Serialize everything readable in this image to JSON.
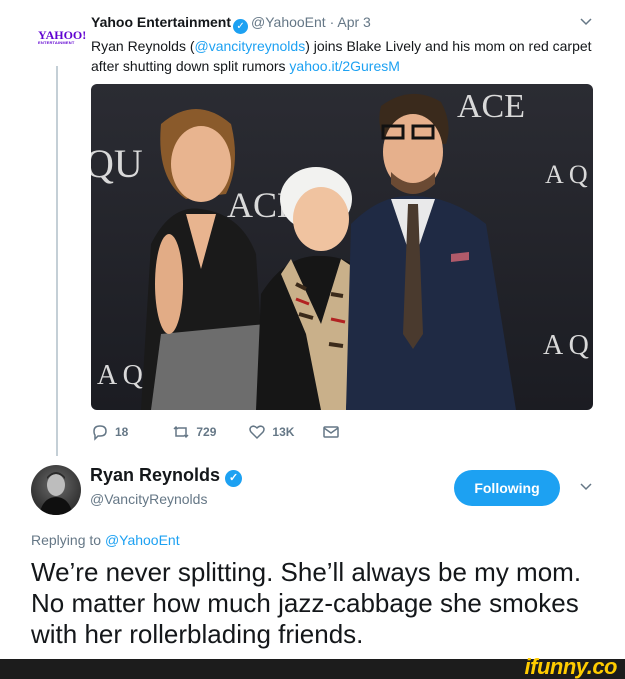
{
  "quoted_tweet": {
    "logo_text": "YAHOO!",
    "logo_subtext": "ENTERTAINMENT",
    "name": "Yahoo Entertainment",
    "verified_icon": "✓",
    "handle": "@YahooEnt",
    "separator": " · ",
    "date": "Apr 3",
    "text_before": "Ryan Reynolds (",
    "mention": "@vancityreynolds",
    "text_after": ") joins Blake Lively and his mom on red carpet after shutting down split rumors ",
    "link": "yahoo.it/2GuresM",
    "photo_text": {
      "ace_top": "ACE",
      "qu_left": "QU",
      "ace_mid": "ACE",
      "aq_right_top": "A Q",
      "aq_right_bottom": "A Q",
      "aq_left_bottom": "A Q"
    },
    "actions": {
      "replies": "18",
      "retweets": "729",
      "likes": "13K"
    }
  },
  "main_tweet": {
    "name": "Ryan Reynolds",
    "verified_icon": "✓",
    "handle": "@VancityReynolds",
    "follow_label": "Following",
    "replying_prefix": "Replying to ",
    "replying_to": "@YahooEnt",
    "text": "We’re never splitting. She’ll always be my mom. No matter how much jazz-cabbage she smokes with her rollerblading friends."
  },
  "watermark": "ifunny.co",
  "colors": {
    "accent": "#1da1f2",
    "muted": "#657786",
    "yahoo_purple": "#5f01d1",
    "watermark": "#ffcc00"
  }
}
